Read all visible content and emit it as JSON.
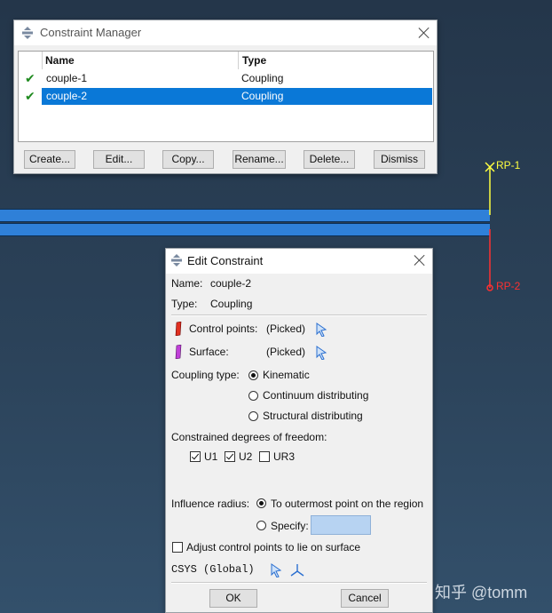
{
  "viewport": {
    "rp1_label": "RP-1",
    "rp2_label": "RP-2",
    "watermark": "知乎 @tomm",
    "colors": {
      "rp1": "#ffff40",
      "rp2": "#ff3030",
      "beam": "#2f80d8"
    }
  },
  "constraint_manager": {
    "title": "Constraint Manager",
    "columns": [
      "Name",
      "Type"
    ],
    "rows": [
      {
        "name": "couple-1",
        "type": "Coupling",
        "selected": false
      },
      {
        "name": "couple-2",
        "type": "Coupling",
        "selected": true
      }
    ],
    "buttons": {
      "create": "Create...",
      "edit": "Edit...",
      "copy": "Copy...",
      "rename": "Rename...",
      "delete": "Delete...",
      "dismiss": "Dismiss"
    }
  },
  "edit_constraint": {
    "title": "Edit Constraint",
    "name_label": "Name:",
    "name_value": "couple-2",
    "type_label": "Type:",
    "type_value": "Coupling",
    "control_points_label": "Control points:",
    "control_points_value": "(Picked)",
    "surface_label": "Surface:",
    "surface_value": "(Picked)",
    "coupling_type_label": "Coupling type:",
    "coupling_options": [
      "Kinematic",
      "Continuum distributing",
      "Structural distributing"
    ],
    "coupling_selected": "Kinematic",
    "dof_label": "Constrained degrees of freedom:",
    "dof": [
      {
        "label": "U1",
        "checked": true
      },
      {
        "label": "U2",
        "checked": true
      },
      {
        "label": "UR3",
        "checked": false
      }
    ],
    "influence_label": "Influence radius:",
    "influence_option1": "To outermost point on the region",
    "influence_option2": "Specify:",
    "specify_value": "",
    "adjust_label": "Adjust control points to lie on surface",
    "csys_label": "CSYS (Global)",
    "ok_label": "OK",
    "cancel_label": "Cancel"
  }
}
